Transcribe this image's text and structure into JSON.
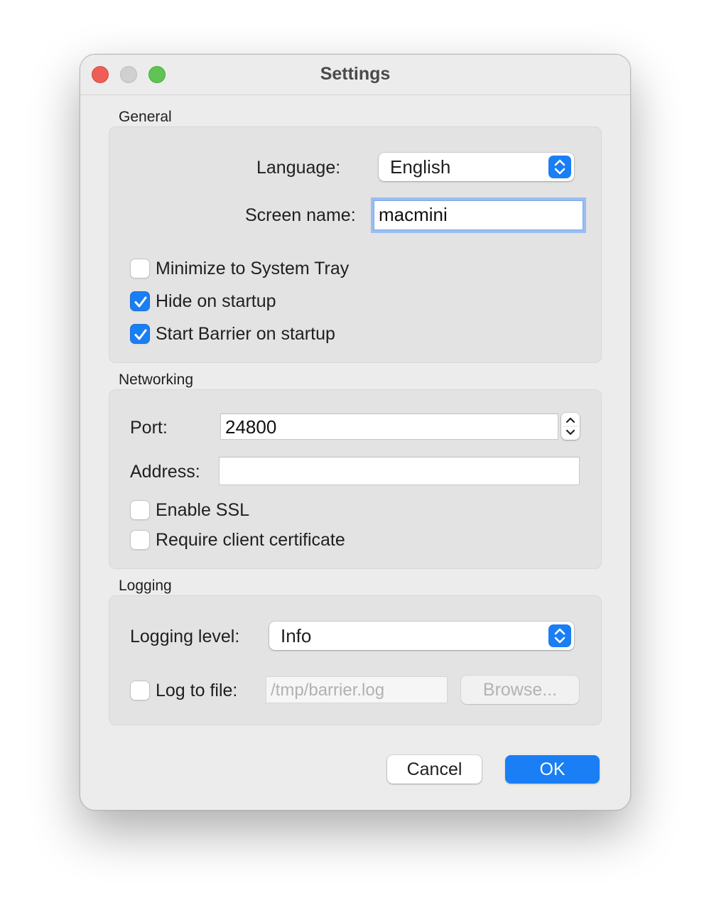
{
  "window": {
    "title": "Settings"
  },
  "general": {
    "section_label": "General",
    "language_label": "Language:",
    "language_value": "English",
    "screen_name_label": "Screen name:",
    "screen_name_value": "macmini",
    "checkboxes": [
      {
        "label": "Minimize to System Tray",
        "checked": false
      },
      {
        "label": "Hide on startup",
        "checked": true
      },
      {
        "label": "Start Barrier on startup",
        "checked": true
      }
    ]
  },
  "networking": {
    "section_label": "Networking",
    "port_label": "Port:",
    "port_value": "24800",
    "address_label": "Address:",
    "address_value": "",
    "checkboxes": [
      {
        "label": "Enable SSL",
        "checked": false
      },
      {
        "label": "Require client certificate",
        "checked": false
      }
    ]
  },
  "logging": {
    "section_label": "Logging",
    "level_label": "Logging level:",
    "level_value": "Info",
    "log_to_file_label": "Log to file:",
    "log_to_file_checked": false,
    "log_file_placeholder": "/tmp/barrier.log",
    "browse_label": "Browse..."
  },
  "buttons": {
    "cancel_label": "Cancel",
    "ok_label": "OK"
  },
  "colors": {
    "accent": "#1a7ef4",
    "window_bg": "#ececec",
    "group_bg": "#e3e3e3"
  }
}
